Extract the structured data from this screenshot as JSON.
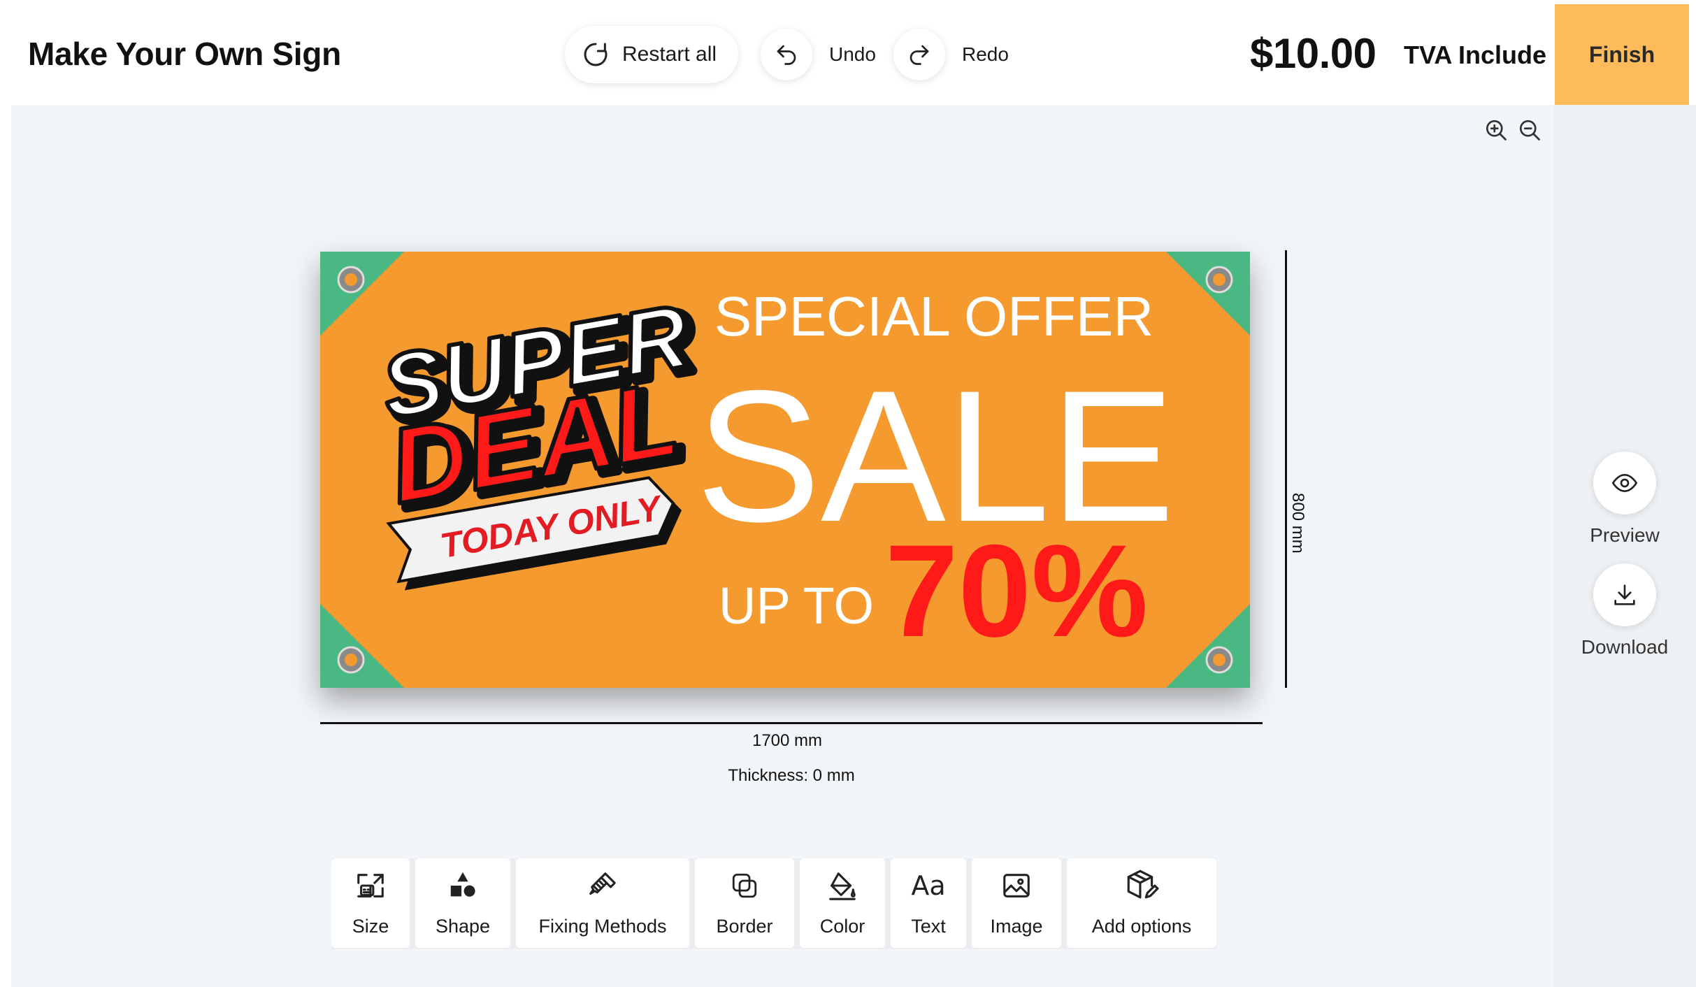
{
  "header": {
    "title": "Make Your Own Sign",
    "restart_label": "Restart all",
    "undo_label": "Undo",
    "redo_label": "Redo",
    "price": "$10.00",
    "tax_label": "TVA Include",
    "finish_label": "Finish"
  },
  "sign": {
    "background_color": "#f59a2e",
    "corner_color": "#49b882",
    "line_super": "SUPER",
    "line_deal": "DEAL",
    "line_today": "TODAY ONLY",
    "line_special": "SPECIAL OFFER",
    "line_sale": "SALE",
    "line_upto": "UP TO",
    "line_percent": "70%",
    "accent_red": "#ff1a1a"
  },
  "dimensions": {
    "width_label": "1700 mm",
    "height_label": "800 mm",
    "thickness_label": "Thickness: 0 mm"
  },
  "toolbar": {
    "items": [
      {
        "label": "Size",
        "icon": "resize-icon"
      },
      {
        "label": "Shape",
        "icon": "shapes-icon"
      },
      {
        "label": "Fixing Methods",
        "icon": "screw-icon"
      },
      {
        "label": "Border",
        "icon": "border-icon"
      },
      {
        "label": "Color",
        "icon": "paint-bucket-icon"
      },
      {
        "label": "Text",
        "icon": "text-icon"
      },
      {
        "label": "Image",
        "icon": "image-icon"
      },
      {
        "label": "Add options",
        "icon": "box-edit-icon"
      }
    ]
  },
  "side_actions": {
    "preview_label": "Preview",
    "download_label": "Download"
  },
  "colors": {
    "finish_bg": "#fdbb5b",
    "workspace_bg": "#f3f6f9"
  }
}
